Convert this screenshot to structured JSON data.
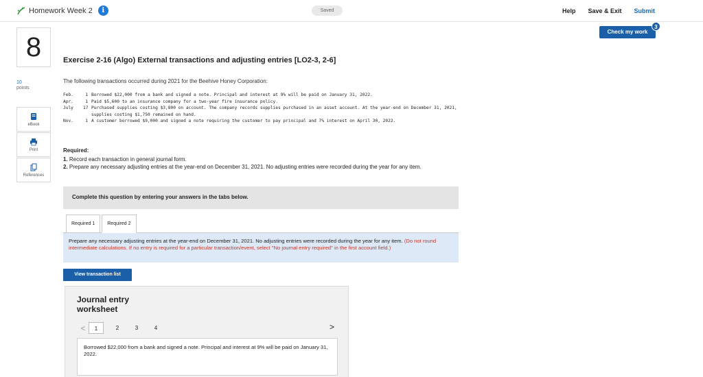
{
  "topbar": {
    "assignment_title": "Homework Week 2",
    "info_glyph": "i",
    "saved_label": "Saved",
    "help_label": "Help",
    "save_exit_label": "Save & Exit",
    "submit_label": "Submit"
  },
  "check_work": {
    "label": "Check my work",
    "badge_count": "3"
  },
  "question": {
    "number": "8",
    "points_value": "10",
    "points_label": "points",
    "tools": [
      {
        "label": "eBook",
        "icon": "ebook-icon"
      },
      {
        "label": "Print",
        "icon": "print-icon"
      },
      {
        "label": "References",
        "icon": "references-icon"
      }
    ]
  },
  "exercise": {
    "title": "Exercise 2-16 (Algo) External transactions and adjusting entries [LO2-3, 2-6]",
    "intro": "The following transactions occurred during 2021 for the Beehive Honey Corporation:",
    "transactions": [
      {
        "month": "Feb.",
        "day": "1",
        "text": "Borrowed $22,000 from a bank and signed a note. Principal and interest at 9% will be paid on January 31, 2022."
      },
      {
        "month": "Apr.",
        "day": "1",
        "text": "Paid $5,600 to an insurance company for a two-year fire insurance policy."
      },
      {
        "month": "July",
        "day": "17",
        "text": "Purchased supplies costing $3,800 on account. The company records supplies purchased in an asset account. At the year-end on December 31, 2021, supplies costing $1,750 remained on hand."
      },
      {
        "month": "Nov.",
        "day": "1",
        "text": "A customer borrowed $9,000 and signed a note requiring the customer to pay principal and 7% interest on April 30, 2022."
      }
    ],
    "required_heading": "Required:",
    "required_items": [
      {
        "num": "1.",
        "text": "Record each transaction in general journal form."
      },
      {
        "num": "2.",
        "text": "Prepare any necessary adjusting entries at the year-end on December 31, 2021. No adjusting entries were recorded during the year for any item."
      }
    ],
    "complete_prompt": "Complete this question by entering your answers in the tabs below."
  },
  "tabs": [
    {
      "label": "Required 1"
    },
    {
      "label": "Required 2"
    }
  ],
  "instructions": {
    "main": "Prepare any necessary adjusting entries at the year-end on December 31, 2021. No adjusting entries were recorded during the year for any item.",
    "note": "(Do not round intermediate calculations. If no entry is required for a particular transaction/event, select \"No journal entry required\" in the first account field.)"
  },
  "view_transaction_label": "View transaction list",
  "journal": {
    "title_line1": "Journal entry",
    "title_line2": "worksheet",
    "prev_glyph": "<",
    "next_glyph": ">",
    "pages": [
      "1",
      "2",
      "3",
      "4"
    ],
    "description": "Borrowed $22,000 from a bank and signed a note. Principal and interest at 9% will be paid on January 31, 2022."
  },
  "colors": {
    "accent": "#1b5fa8",
    "link": "#1a66b5",
    "instruction_bg": "#dde9f7",
    "note_red": "#c0392b"
  }
}
